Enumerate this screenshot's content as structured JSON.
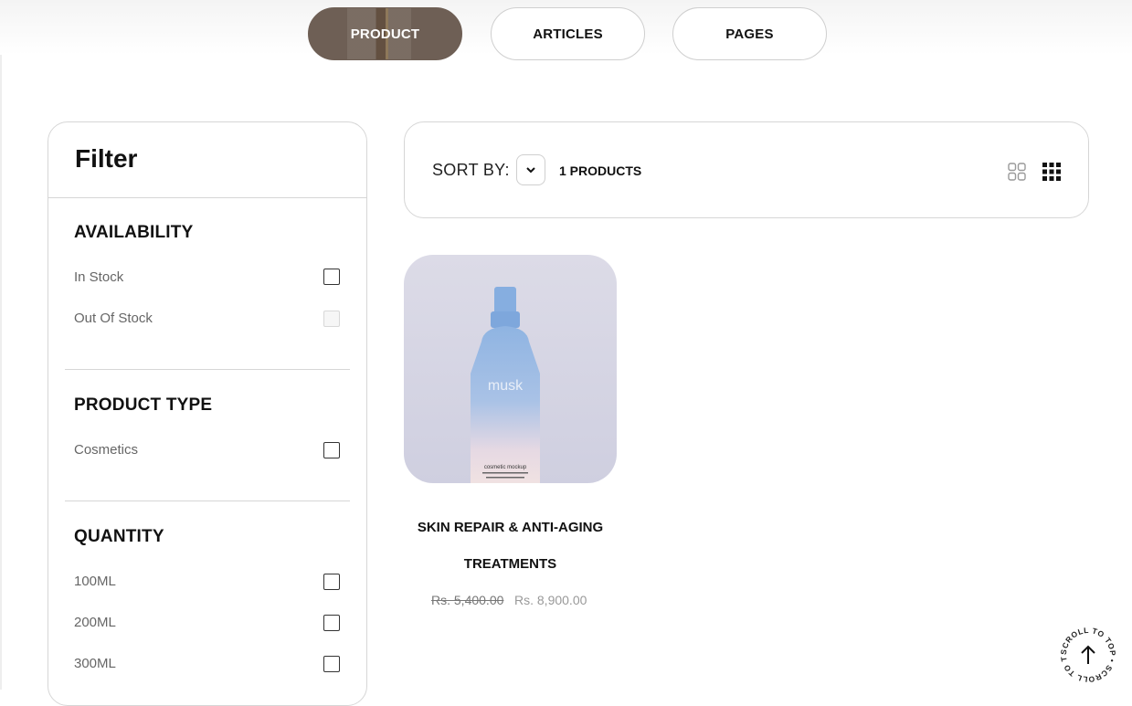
{
  "tabs": [
    {
      "label": "PRODUCT",
      "active": true
    },
    {
      "label": "ARTICLES",
      "active": false
    },
    {
      "label": "PAGES",
      "active": false
    }
  ],
  "filter": {
    "title": "Filter",
    "groups": [
      {
        "title": "AVAILABILITY",
        "options": [
          {
            "label": "In Stock",
            "checked": false,
            "disabled": false
          },
          {
            "label": "Out Of Stock",
            "checked": false,
            "disabled": true
          }
        ]
      },
      {
        "title": "PRODUCT TYPE",
        "options": [
          {
            "label": "Cosmetics",
            "checked": false,
            "disabled": false
          }
        ]
      },
      {
        "title": "QUANTITY",
        "options": [
          {
            "label": "100ML",
            "checked": false,
            "disabled": false
          },
          {
            "label": "200ML",
            "checked": false,
            "disabled": false
          },
          {
            "label": "300ML",
            "checked": false,
            "disabled": false
          }
        ]
      }
    ]
  },
  "toolbar": {
    "sort_label": "SORT BY:",
    "sort_value": "",
    "count": "1 PRODUCTS",
    "views": [
      {
        "icon": "grid-2-icon",
        "active": false
      },
      {
        "icon": "grid-3-icon",
        "active": true
      }
    ]
  },
  "product": {
    "name_line1": "SKIN REPAIR & ANTI-AGING",
    "name_line2": "TREATMENTS",
    "price_old": "Rs. 5,400.00",
    "price_new": "Rs. 8,900.00",
    "bottle_brand": "musk",
    "bottle_caption": "cosmetic mockup"
  },
  "scroll_top": {
    "text": "SCROLL TO TOP • SCROLL TO TOP •",
    "icon": "arrow-up-icon"
  },
  "colors": {
    "active_tab": "#6e5f55",
    "border": "#d6d6d6",
    "muted_text": "#666666"
  }
}
